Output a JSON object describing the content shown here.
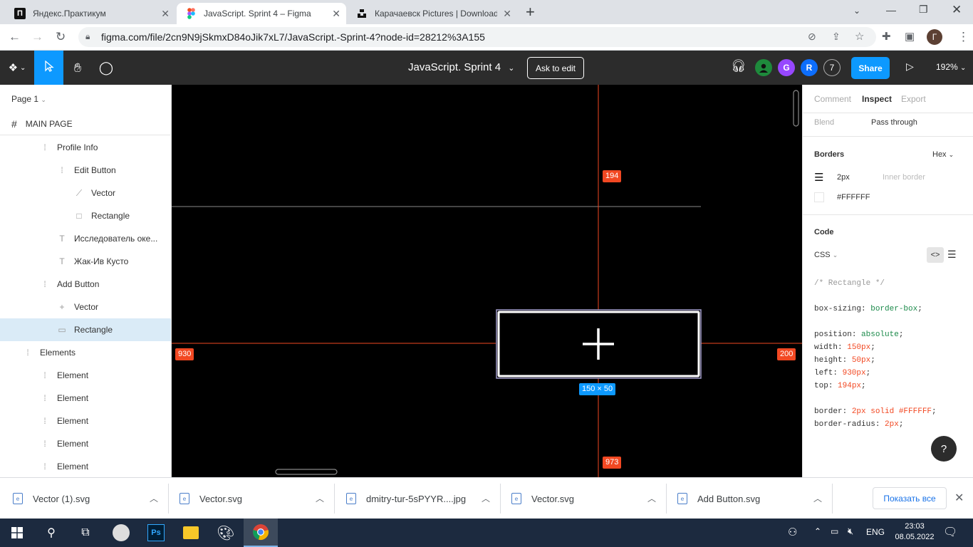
{
  "browser": {
    "tabs": [
      {
        "title": "Яндекс.Практикум",
        "icon": "yandex-practicum-icon"
      },
      {
        "title": "JavaScript. Sprint 4 – Figma",
        "icon": "figma-icon"
      },
      {
        "title": "Карачаевск Pictures | Download",
        "icon": "unsplash-icon"
      }
    ],
    "new_tab": "+",
    "url": "figma.com/file/2cn9N9jSkmxD84oJik7xL7/JavaScript.-Sprint-4?node-id=28212%3A155",
    "profile_initial": "Г"
  },
  "figma": {
    "file_title": "JavaScript. Sprint 4",
    "ask_to_edit": "Ask to edit",
    "share": "Share",
    "zoom": "192%",
    "avatars": [
      {
        "label": "",
        "color": "#1e8a3c"
      },
      {
        "label": "G",
        "color": "#9747ff"
      },
      {
        "label": "R",
        "color": "#0d6efd"
      },
      {
        "label": "7",
        "color": "#2c2c2c"
      }
    ]
  },
  "layers": {
    "page": "Page 1",
    "main_page": "MAIN PAGE",
    "items": [
      {
        "label": "Profile Info",
        "indent": 3,
        "type": "frame"
      },
      {
        "label": "Edit Button",
        "indent": 4,
        "type": "frame"
      },
      {
        "label": "Vector",
        "indent": 5,
        "type": "vector"
      },
      {
        "label": "Rectangle",
        "indent": 5,
        "type": "rect"
      },
      {
        "label": "Исследователь оке...",
        "indent": 4,
        "type": "text"
      },
      {
        "label": "Жак-Ив Кусто",
        "indent": 4,
        "type": "text"
      },
      {
        "label": "Add Button",
        "indent": 3,
        "type": "frame"
      },
      {
        "label": "Vector",
        "indent": 4,
        "type": "plus"
      },
      {
        "label": "Rectangle",
        "indent": 4,
        "type": "line",
        "selected": true
      },
      {
        "label": "Elements",
        "indent": 2,
        "type": "frame"
      },
      {
        "label": "Element",
        "indent": 3,
        "type": "frame"
      },
      {
        "label": "Element",
        "indent": 3,
        "type": "frame"
      },
      {
        "label": "Element",
        "indent": 3,
        "type": "frame"
      },
      {
        "label": "Element",
        "indent": 3,
        "type": "frame"
      },
      {
        "label": "Element",
        "indent": 3,
        "type": "frame"
      }
    ]
  },
  "canvas": {
    "top_distance": "194",
    "left_distance": "930",
    "right_distance": "200",
    "bottom_distance": "973",
    "size_label": "150 × 50"
  },
  "inspect": {
    "tabs": [
      "Comment",
      "Inspect",
      "Export"
    ],
    "blend_label": "Blend",
    "blend_value": "Pass through",
    "borders_title": "Borders",
    "color_format": "Hex",
    "border_width": "2px",
    "border_position": "Inner border",
    "border_color": "#FFFFFF",
    "code_title": "Code",
    "code_lang": "CSS",
    "code_comment": "/* Rectangle */",
    "code_lines": [
      {
        "prop": "box-sizing",
        "val": "border-box",
        "kind": "kw"
      },
      {
        "prop": "position",
        "val": "absolute",
        "kind": "kw"
      },
      {
        "prop": "width",
        "val": "150px",
        "kind": "num"
      },
      {
        "prop": "height",
        "val": "50px",
        "kind": "num"
      },
      {
        "prop": "left",
        "val": "930px",
        "kind": "num"
      },
      {
        "prop": "top",
        "val": "194px",
        "kind": "num"
      },
      {
        "prop": "border",
        "val": "2px solid #FFFFFF",
        "kind": "num"
      },
      {
        "prop": "border-radius",
        "val": "2px",
        "kind": "num"
      }
    ],
    "help": "?"
  },
  "downloads": {
    "items": [
      "Vector (1).svg",
      "Vector.svg",
      "dmitry-tur-5sPYYR....jpg",
      "Vector.svg",
      "Add Button.svg"
    ],
    "show_all": "Показать все"
  },
  "taskbar": {
    "lang": "ENG",
    "time": "23:03",
    "date": "08.05.2022"
  }
}
